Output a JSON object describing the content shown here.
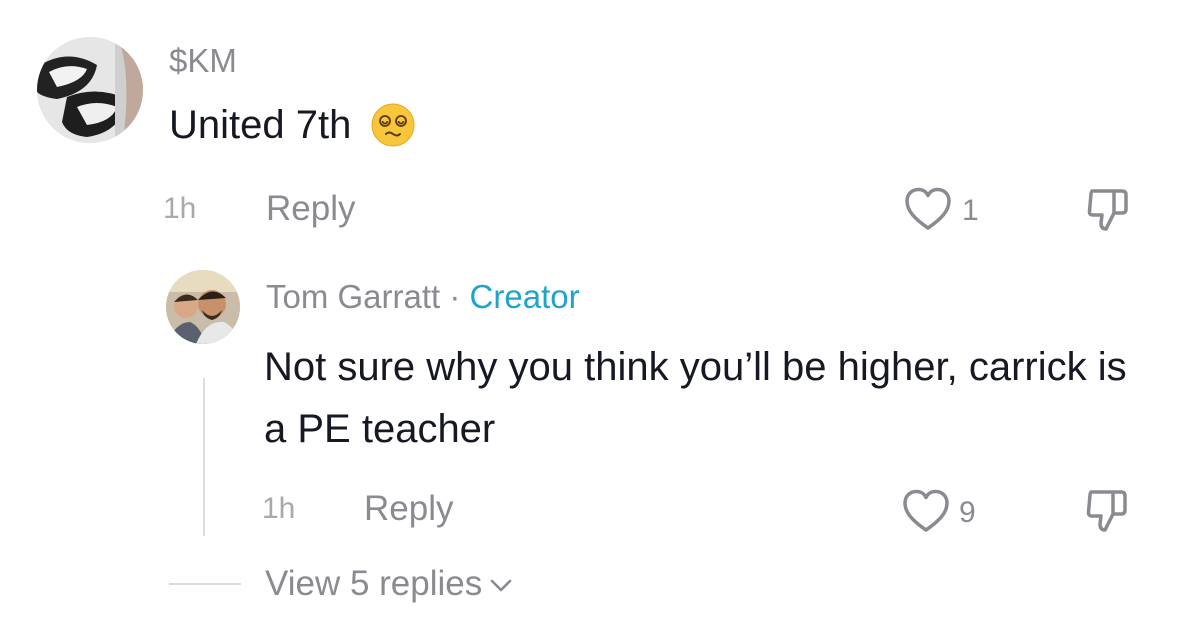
{
  "comment": {
    "username": "$KM",
    "text": "United 7th",
    "emoji": "dizzy-face-emoji",
    "time": "1h",
    "reply_label": "Reply",
    "like_count": "1"
  },
  "reply": {
    "username": "Tom Garratt",
    "separator": "·",
    "badge": "Creator",
    "text": "Not sure why you think you’ll be higher, carrick is a PE teacher",
    "time": "1h",
    "reply_label": "Reply",
    "like_count": "9"
  },
  "view_replies": {
    "label": "View 5 replies"
  },
  "colors": {
    "text_primary": "#161823",
    "text_secondary": "#8a8b91",
    "creator_accent": "#20a4c9",
    "divider": "#dcdce0"
  },
  "icons": [
    "heart-icon",
    "thumbs-down-icon",
    "chevron-down-icon"
  ]
}
